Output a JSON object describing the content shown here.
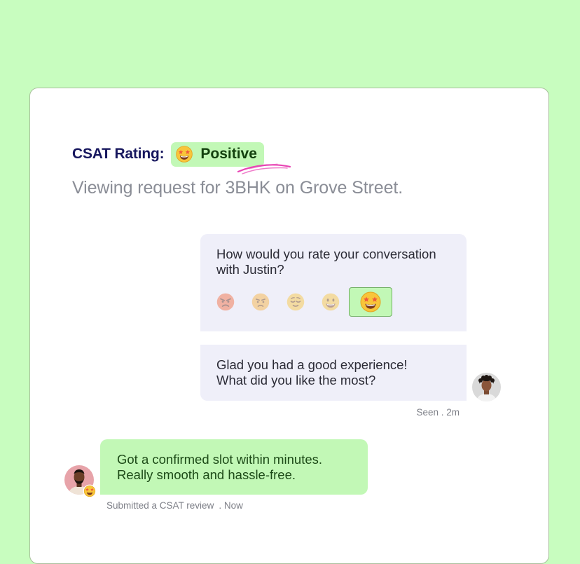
{
  "header": {
    "rating_label": "CSAT Rating:",
    "rating_value": "Positive",
    "rating_icon": "star-struck-emoji-icon",
    "subtitle": "Viewing request for 3BHK on Grove Street."
  },
  "conversation": {
    "question": "How would you rate your conversation with Justin?",
    "rating_options": [
      {
        "icon": "angry-emoji-icon",
        "selected": false
      },
      {
        "icon": "frowning-emoji-icon",
        "selected": false
      },
      {
        "icon": "relieved-emoji-icon",
        "selected": false
      },
      {
        "icon": "smiling-emoji-icon",
        "selected": false
      },
      {
        "icon": "star-struck-emoji-icon",
        "selected": true
      }
    ],
    "followup_line1": "Glad you had a good experience!",
    "followup_line2": "What did you like the most?",
    "seen_status": "Seen . 2m",
    "user_reply_line1": "Got a confirmed slot within minutes.",
    "user_reply_line2": "Really smooth and hassle-free.",
    "user_meta": "Submitted a CSAT review",
    "user_meta_time": ". Now"
  },
  "colors": {
    "background": "#c8fdbf",
    "accent_green": "#c2f8b6",
    "bubble_gray": "#efeff9",
    "heading_navy": "#17175e",
    "highlight_pink": "#e845b4"
  }
}
